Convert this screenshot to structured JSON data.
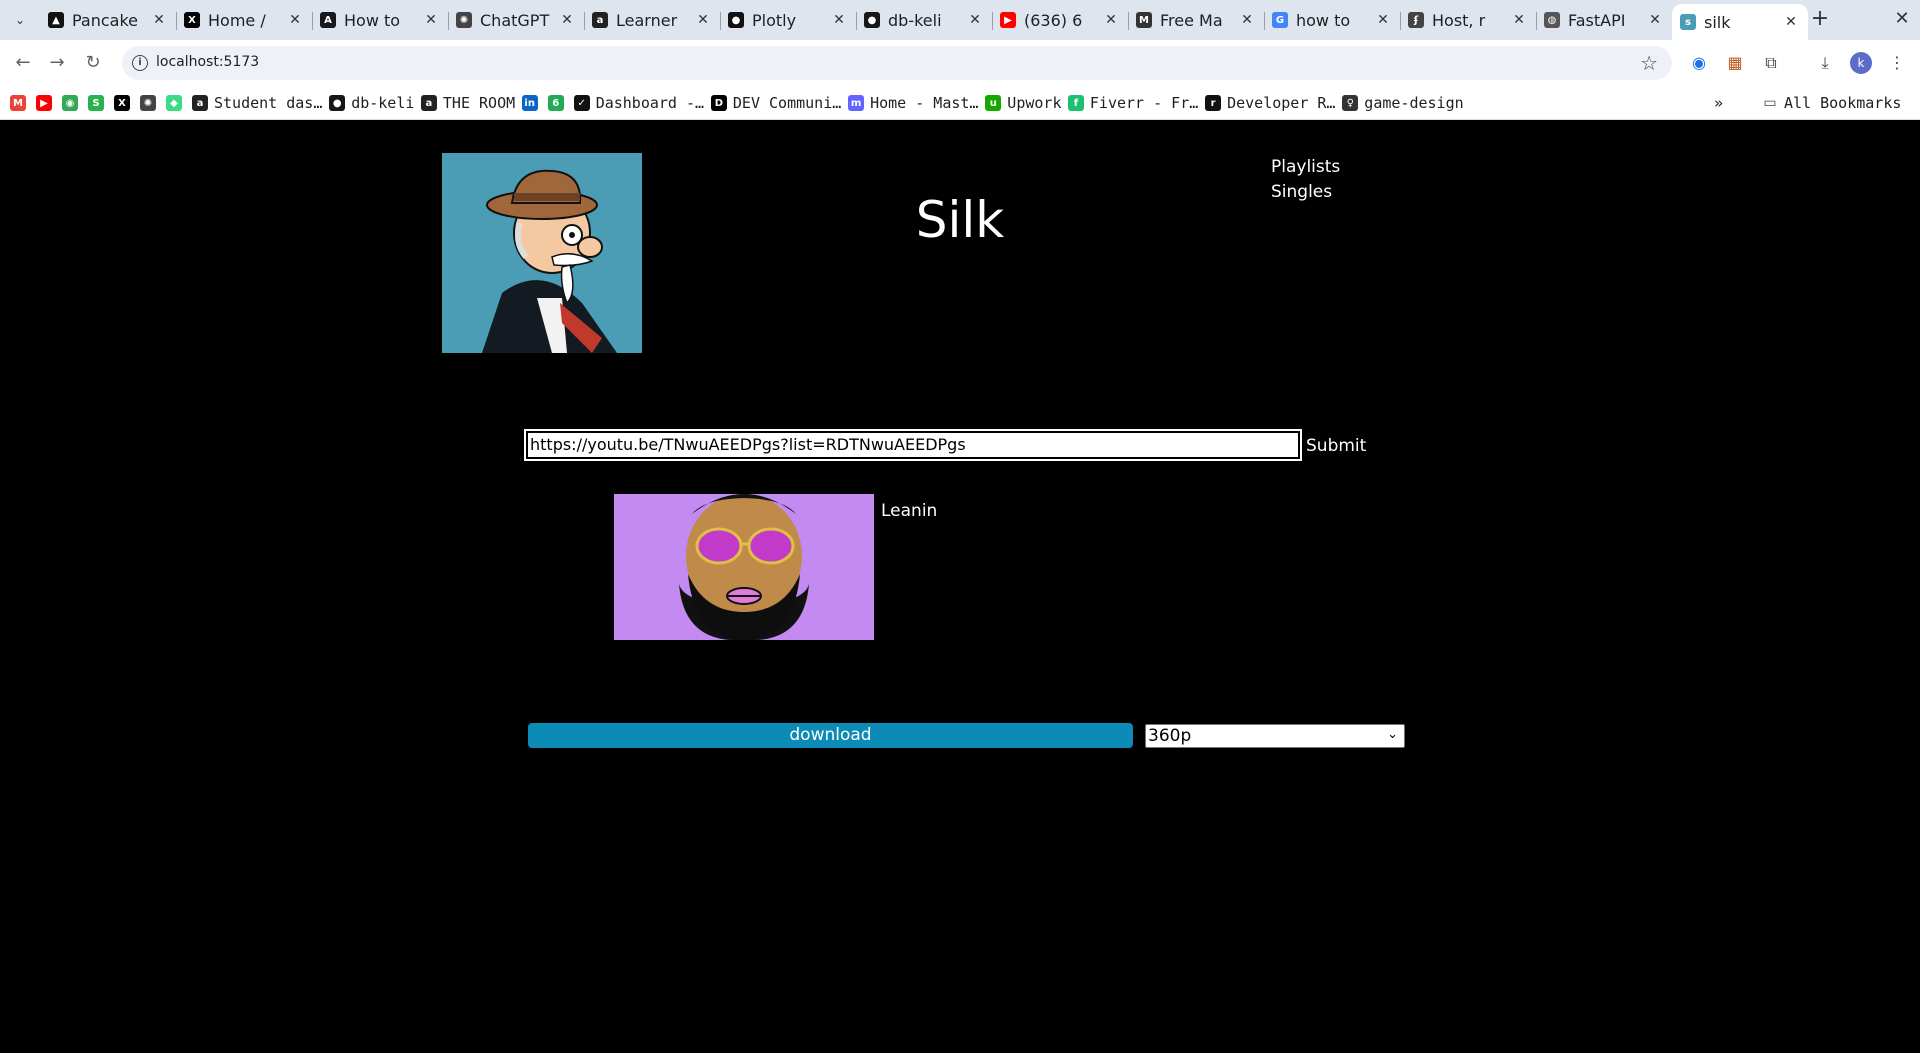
{
  "browser": {
    "tabs": [
      {
        "title": "Pancake",
        "icon": "pancake-icon",
        "color": "#111111",
        "glyph": "▲"
      },
      {
        "title": "Home /",
        "icon": "x-icon",
        "color": "#000000",
        "glyph": "X"
      },
      {
        "title": "How to",
        "icon": "astro-icon",
        "color": "#17191e",
        "glyph": "A"
      },
      {
        "title": "ChatGPT",
        "icon": "chatgpt-icon",
        "color": "#444444",
        "glyph": "✺"
      },
      {
        "title": "Learner",
        "icon": "alx-icon",
        "color": "#222222",
        "glyph": "a"
      },
      {
        "title": "Plotly",
        "icon": "plotly-icon",
        "color": "#111111",
        "glyph": "●"
      },
      {
        "title": "db-keli",
        "icon": "github-icon",
        "color": "#181717",
        "glyph": "●"
      },
      {
        "title": "(636) 6",
        "icon": "youtube-icon",
        "color": "#ff0000",
        "glyph": "▶"
      },
      {
        "title": "Free Ma",
        "icon": "markdown-icon",
        "color": "#333333",
        "glyph": "M"
      },
      {
        "title": "how to",
        "icon": "google-icon",
        "color": "#4285f4",
        "glyph": "G"
      },
      {
        "title": "Host, r",
        "icon": "render-icon",
        "color": "#444444",
        "glyph": "ʄ"
      },
      {
        "title": "FastAPI",
        "icon": "globe-icon",
        "color": "#555555",
        "glyph": "◍"
      },
      {
        "title": "silk",
        "icon": "silk-favicon",
        "color": "#4b9db5",
        "glyph": "s",
        "active": true
      }
    ],
    "url": "localhost:5173",
    "profile_initial": "k",
    "bookmarks": [
      {
        "label": "",
        "icon": "gmail-icon",
        "color": "#ea4335",
        "glyph": "M"
      },
      {
        "label": "",
        "icon": "youtube-icon",
        "color": "#ff0000",
        "glyph": "▶"
      },
      {
        "label": "",
        "icon": "maps-icon",
        "color": "#34a853",
        "glyph": "◉"
      },
      {
        "label": "",
        "icon": "bookmark-green-icon",
        "color": "#2bb24c",
        "glyph": "S"
      },
      {
        "label": "",
        "icon": "x-icon",
        "color": "#000000",
        "glyph": "X"
      },
      {
        "label": "",
        "icon": "chatgpt-icon",
        "color": "#444444",
        "glyph": "✺"
      },
      {
        "label": "",
        "icon": "android-icon",
        "color": "#3ddc84",
        "glyph": "◆"
      },
      {
        "label": "Student das…",
        "icon": "alx-icon",
        "color": "#222222",
        "glyph": "a"
      },
      {
        "label": "db-keli",
        "icon": "github-icon",
        "color": "#181717",
        "glyph": "●"
      },
      {
        "label": "THE ROOM",
        "icon": "alx-icon",
        "color": "#222222",
        "glyph": "a"
      },
      {
        "label": "",
        "icon": "linkedin-icon",
        "color": "#0a66c2",
        "glyph": "in"
      },
      {
        "label": "",
        "icon": "leaf-icon",
        "color": "#22aa55",
        "glyph": "6"
      },
      {
        "label": "Dashboard -…",
        "icon": "check-circle-icon",
        "color": "#111111",
        "glyph": "✓"
      },
      {
        "label": "DEV Communi…",
        "icon": "dev-icon",
        "color": "#000000",
        "glyph": "D"
      },
      {
        "label": "Home - Mast…",
        "icon": "mastodon-icon",
        "color": "#6364ff",
        "glyph": "m"
      },
      {
        "label": "Upwork",
        "icon": "upwork-icon",
        "color": "#14a800",
        "glyph": "u"
      },
      {
        "label": "Fiverr - Fr…",
        "icon": "fiverr-icon",
        "color": "#1dbf73",
        "glyph": "f"
      },
      {
        "label": "Developer R…",
        "icon": "developer-icon",
        "color": "#111111",
        "glyph": "r"
      },
      {
        "label": "game-design",
        "icon": "lightbulb-icon",
        "color": "#333333",
        "glyph": "♀"
      }
    ],
    "all_bookmarks_label": "All Bookmarks"
  },
  "app": {
    "title": "Silk",
    "nav": [
      "Playlists",
      "Singles"
    ],
    "url_input_value": "https://youtu.be/TNwuAEEDPgs?list=RDTNwuAEEDPgs",
    "submit_label": "Submit",
    "result": {
      "title": "Leanin"
    },
    "download_label": "download",
    "quality_selected": "360p",
    "accent_color": "#0b8bb6"
  }
}
